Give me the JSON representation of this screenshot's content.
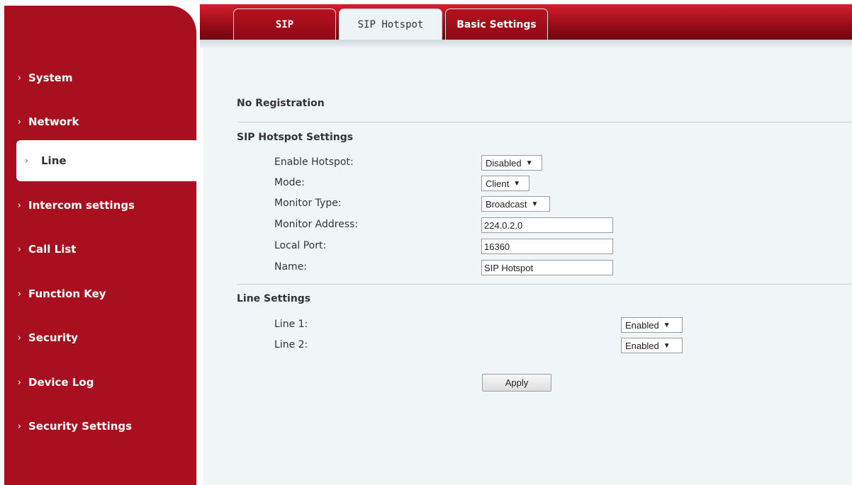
{
  "tabs": [
    {
      "label": "SIP"
    },
    {
      "label": "SIP Hotspot"
    },
    {
      "label": "Basic Settings"
    }
  ],
  "sidebar": {
    "chevron": "›",
    "items": [
      {
        "label": "System"
      },
      {
        "label": "Network"
      },
      {
        "label": "Line",
        "active": true
      },
      {
        "label": "Intercom settings"
      },
      {
        "label": "Call List"
      },
      {
        "label": "Function Key"
      },
      {
        "label": "Security"
      },
      {
        "label": "Device Log"
      },
      {
        "label": "Security Settings"
      }
    ]
  },
  "status": "No Registration",
  "hotspot": {
    "title": "SIP Hotspot Settings",
    "enable_label": "Enable Hotspot:",
    "enable_value": "Disabled",
    "mode_label": "Mode:",
    "mode_value": "Client",
    "monitor_type_label": "Monitor Type:",
    "monitor_type_value": "Broadcast",
    "monitor_address_label": "Monitor Address:",
    "monitor_address_value": "224.0.2.0",
    "local_port_label": "Local Port:",
    "local_port_value": "16360",
    "name_label": "Name:",
    "name_value": "SIP Hotspot"
  },
  "lines": {
    "title": "Line Settings",
    "line1_label": "Line 1:",
    "line1_value": "Enabled",
    "line2_label": "Line 2:",
    "line2_value": "Enabled"
  },
  "apply_label": "Apply",
  "colors": {
    "brand_red": "#a80f1f",
    "content_bg": "#f0f5f7"
  }
}
